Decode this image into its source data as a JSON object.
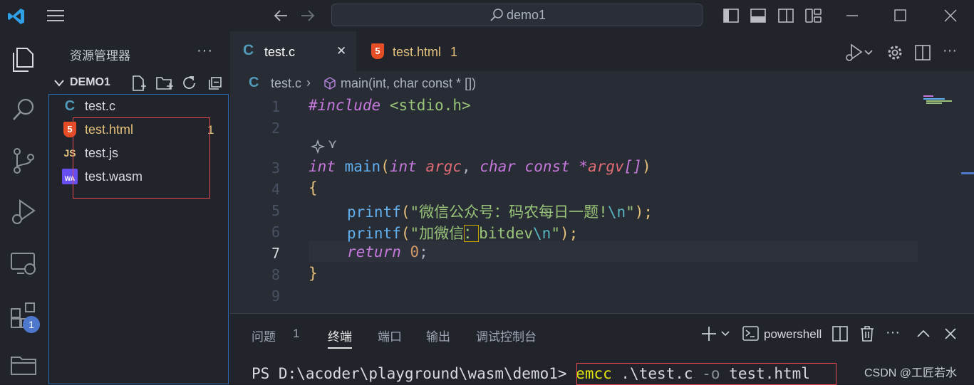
{
  "titlebar": {
    "search_text": "demo1"
  },
  "activity": {
    "extensions_badge": "1"
  },
  "sidebar": {
    "title": "资源管理器",
    "more": "···",
    "folder": "DEMO1",
    "files": [
      {
        "name": "test.c",
        "icon": "C",
        "badge": ""
      },
      {
        "name": "test.html",
        "icon": "5",
        "badge": "1"
      },
      {
        "name": "test.js",
        "icon": "JS",
        "badge": ""
      },
      {
        "name": "test.wasm",
        "icon": "WA",
        "badge": ""
      }
    ]
  },
  "tabs": [
    {
      "label": "test.c",
      "icon": "C",
      "close": "✕"
    },
    {
      "label": "test.html",
      "icon": "5",
      "badge": "1"
    }
  ],
  "breadcrumb": {
    "file": "test.c",
    "sep": "›",
    "symbol": "main(int, char const * [])"
  },
  "editor": {
    "line_numbers": [
      "1",
      "2",
      "3",
      "4",
      "5",
      "6",
      "7",
      "8",
      "9"
    ],
    "codelens": "⋎",
    "lines": {
      "l1_directive": "#include",
      "l1_header": "<stdio.h>",
      "l3_int": "int",
      "l3_main": "main",
      "l3_open": "(",
      "l3_int2": "int",
      "l3_argc": "argc",
      "l3_comma": ",",
      "l3_char": "char",
      "l3_const": "const",
      "l3_star": "*",
      "l3_argv": "argv",
      "l3_brackets": "[]",
      "l3_close": ")",
      "l4": "{",
      "l5_fn": "printf",
      "l5_open": "(",
      "l5_str": "\"微信公众号：码农每日一题!",
      "l5_esc": "\\n",
      "l5_end": "\"",
      "l5_close": ");",
      "l6_fn": "printf",
      "l6_open": "(",
      "l6_str_a": "\"加微信",
      "l6_colon": "：",
      "l6_str_b": "bitdev",
      "l6_esc": "\\n",
      "l6_end": "\"",
      "l6_close": ");",
      "l7_return": "return",
      "l7_zero": "0",
      "l7_semi": ";",
      "l8": "}"
    }
  },
  "panel": {
    "tabs": [
      "问题",
      "终端",
      "端口",
      "输出",
      "调试控制台"
    ],
    "problems_count": "1",
    "shell_label": "powershell",
    "prompt": "PS D:\\acoder\\playground\\wasm\\demo1>",
    "command_emcc": "emcc",
    "command_args": ".\\test.c",
    "command_flag": "-o",
    "command_out": "test.html"
  },
  "watermark": "CSDN @工匠若水",
  "colors": {
    "accent": "#2e6ab3",
    "highlight_box": "#e5484d",
    "html_orange": "#e37933",
    "c_blue": "#519aba"
  }
}
